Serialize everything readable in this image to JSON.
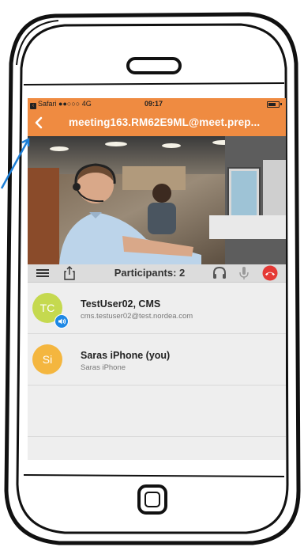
{
  "status_bar": {
    "carrier": "Safari",
    "signal": "●●○○○",
    "network": "4G",
    "time": "09:17"
  },
  "nav": {
    "back_icon": "chevron-left-icon",
    "title": "meeting163.RM62E9ML@meet.prep..."
  },
  "toolbar": {
    "menu_icon": "hamburger-menu-icon",
    "share_icon": "share-icon",
    "participants_label": "Participants: 2",
    "headset_icon": "headset-icon",
    "mic_icon": "microphone-icon",
    "hangup_icon": "hang-up-icon"
  },
  "participants": [
    {
      "initials": "TC",
      "name": "TestUser02, CMS",
      "detail": "cms.testuser02@test.nordea.com",
      "avatar_color": "#c5d94f",
      "speaking": true
    },
    {
      "initials": "Si",
      "name": "Saras iPhone (you)",
      "detail": "Saras iPhone",
      "avatar_color": "#f4b63f",
      "speaking": false
    }
  ],
  "colors": {
    "accent": "#ef8b41",
    "hangup": "#e53935",
    "speaker_badge": "#1e88e5"
  }
}
